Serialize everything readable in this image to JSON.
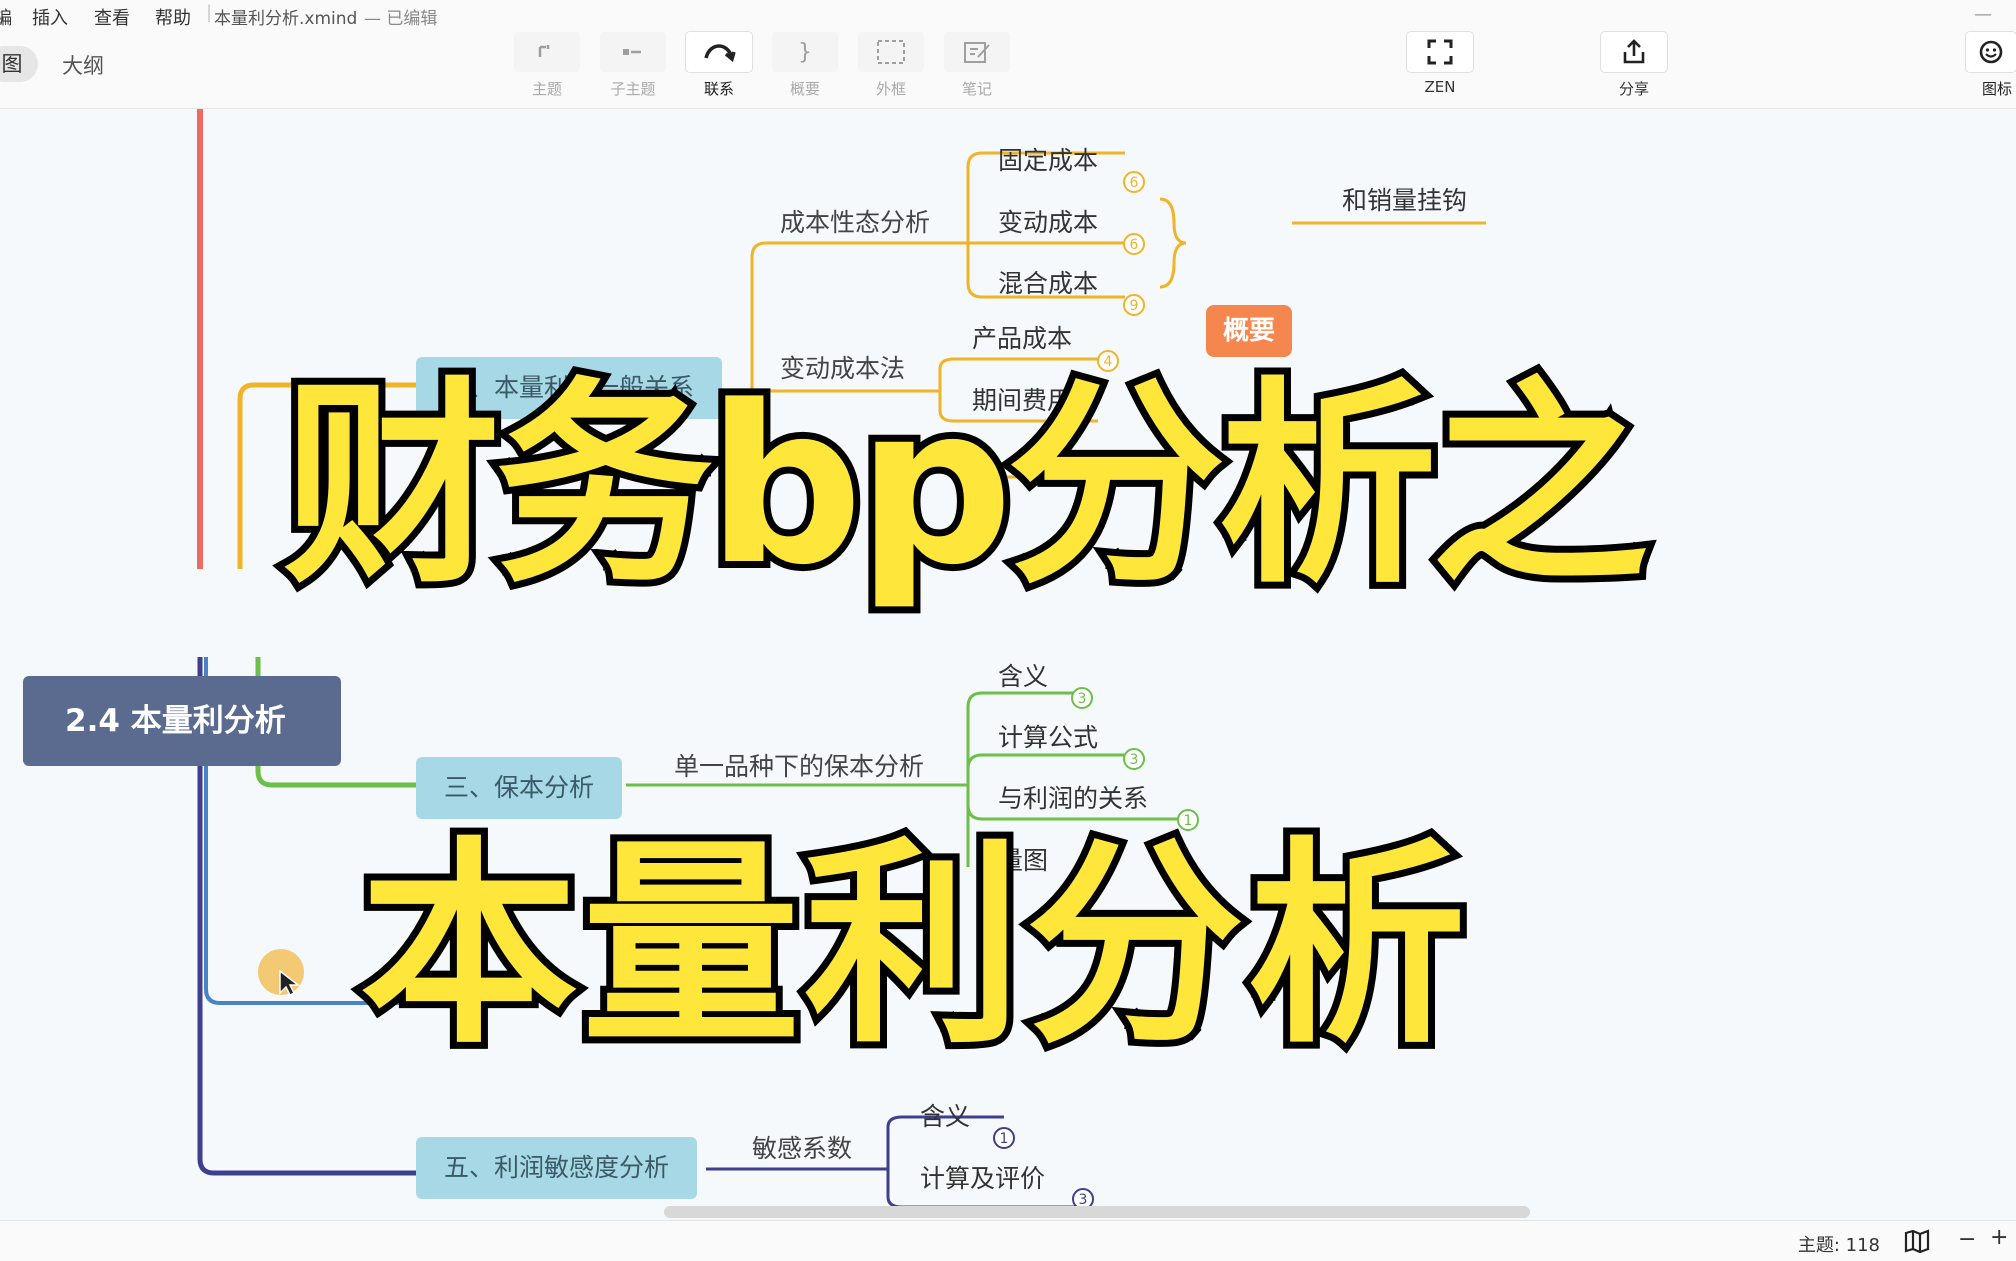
{
  "menubar": {
    "items": [
      "編",
      "插入",
      "查看",
      "帮助"
    ],
    "filename": "本量利分析.xmind",
    "edit_status": "— 已编辑"
  },
  "toolbar": {
    "view_tabs": [
      "图",
      "大纲"
    ],
    "tools": [
      {
        "label": "主题",
        "icon": "topic-icon"
      },
      {
        "label": "子主题",
        "icon": "subtopic-icon"
      },
      {
        "label": "联系",
        "icon": "relationship-icon"
      },
      {
        "label": "概要",
        "icon": "summary-icon"
      },
      {
        "label": "外框",
        "icon": "boundary-icon"
      },
      {
        "label": "笔记",
        "icon": "note-icon"
      }
    ],
    "zen_label": "ZEN",
    "share_label": "分享",
    "sticker_label": "图标"
  },
  "mindmap": {
    "root": "2.4 本量利分析",
    "branches": [
      {
        "label": "二、本量利的一般关系",
        "color": "#f0b429"
      },
      {
        "label": "三、保本分析",
        "color": "#6cc04a"
      },
      {
        "label": "五、利润敏感度分析",
        "color": "#3f3f8f"
      }
    ],
    "cost_behavior": "成本性态分析",
    "cost_items": [
      {
        "label": "固定成本",
        "badge": "6"
      },
      {
        "label": "变动成本",
        "badge": "6"
      },
      {
        "label": "混合成本",
        "badge": "9"
      }
    ],
    "summary_tag": "概要",
    "summary_text": "和销量挂钩",
    "variable_costing": "变动成本法",
    "variable_items": [
      {
        "label": "产品成本",
        "badge": "4"
      },
      {
        "label": "期间费用",
        "badge": ""
      }
    ],
    "partial_label": "相",
    "breakeven_sub": "单一品种下的保本分析",
    "breakeven_items": [
      {
        "label": "含义",
        "badge": "3"
      },
      {
        "label": "计算公式",
        "badge": "3"
      },
      {
        "label": "与利润的关系",
        "badge": "1"
      },
      {
        "label": "量图",
        "badge": "1"
      }
    ],
    "sensitivity_sub": "敏感系数",
    "sensitivity_items": [
      {
        "label": "含义",
        "badge": "1"
      },
      {
        "label": "计算及评价",
        "badge": "3"
      }
    ]
  },
  "overlay": {
    "line1": "财务bp分析之",
    "line2": "本量利分析",
    "fill_color": "#ffe63a"
  },
  "statusbar": {
    "topic_count": "主题: 118",
    "zoom_out": "−",
    "zoom_in": "+"
  }
}
